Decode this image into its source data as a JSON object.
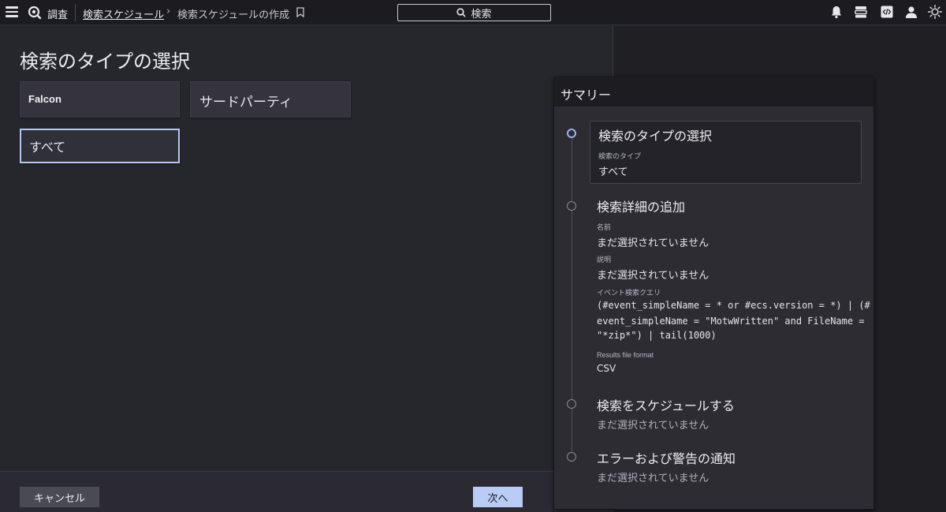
{
  "topbar": {
    "app_label": "調査",
    "breadcrumb_link": "検索スケジュール",
    "breadcrumb_sep": "›",
    "breadcrumb_current": "検索スケジュールの作成",
    "search_label": "検索"
  },
  "main": {
    "title": "検索のタイプの選択",
    "types": [
      "Falcon",
      "サードパーティ",
      "すべて"
    ],
    "selected_type": "すべて"
  },
  "footer": {
    "cancel_label": "キャンセル",
    "next_label": "次へ"
  },
  "summary": {
    "heading": "サマリー",
    "steps": [
      {
        "title": "検索のタイプの選択",
        "fields": [
          {
            "label": "検索のタイプ",
            "value": "すべて"
          }
        ]
      },
      {
        "title": "検索詳細の追加",
        "fields": [
          {
            "label": "名前",
            "value": "まだ選択されていません"
          },
          {
            "label": "説明",
            "value": "まだ選択されていません"
          },
          {
            "label": "イベント検索クエリ",
            "lines": [
              "(#event_simpleName = * or #ecs.version = *) | (#",
              "event_simpleName = \"MotwWritten\" and FileName =",
              "\"*zip*\") | tail(1000)"
            ]
          },
          {
            "label": "Results file format",
            "value": "CSV"
          }
        ]
      },
      {
        "title": "検索をスケジュールする",
        "status": "まだ選択されていません"
      },
      {
        "title": "エラーおよび警告の通知",
        "status": "まだ選択されていません"
      }
    ]
  },
  "colors": {
    "accent": "#b9ccf6",
    "background": "#26262d",
    "topbar": "#1b1b20"
  }
}
